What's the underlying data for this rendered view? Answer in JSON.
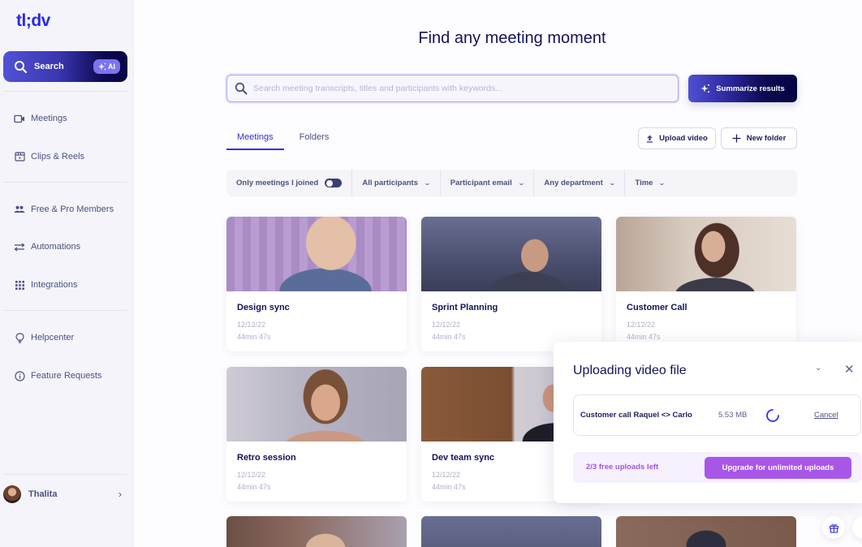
{
  "app": {
    "logo": "tl;dv"
  },
  "sidebar": {
    "search": {
      "label": "Search",
      "ai_badge": "AI",
      "icon": "search-icon"
    },
    "groups": [
      [
        {
          "label": "Meetings",
          "icon": "video-camera-icon"
        },
        {
          "label": "Clips & Reels",
          "icon": "clapperboard-icon"
        }
      ],
      [
        {
          "label": "Free & Pro Members",
          "icon": "people-icon"
        },
        {
          "label": "Automations",
          "icon": "arrows-exchange-icon"
        },
        {
          "label": "Integrations",
          "icon": "grid-icon"
        }
      ],
      [
        {
          "label": "Helpcenter",
          "icon": "lightbulb-icon"
        },
        {
          "label": "Feature Requests",
          "icon": "info-icon"
        }
      ]
    ],
    "user": {
      "name": "Thalita"
    }
  },
  "main": {
    "title": "Find any meeting moment",
    "search": {
      "placeholder": "Search meeting transcripts, titles and participants with keywords...",
      "value": ""
    },
    "summarize_label": "Summarize results",
    "tabs": [
      {
        "label": "Meetings",
        "active": true
      },
      {
        "label": "Folders",
        "active": false
      }
    ],
    "upload_video_label": "Upload video",
    "new_folder_label": "New folder",
    "filters": {
      "only_joined_label": "Only meetings I joined",
      "only_joined_on": false,
      "dropdowns": [
        "All participants",
        "Participant email",
        "Any department",
        "Time"
      ]
    },
    "meetings": [
      {
        "title": "Design sync",
        "date": "12/12/22",
        "duration": "44min 47s"
      },
      {
        "title": "Sprint Planning",
        "date": "12/12/22",
        "duration": "44min 47s"
      },
      {
        "title": "Customer Call",
        "date": "12/12/22",
        "duration": "44min 47s"
      },
      {
        "title": "Retro session",
        "date": "12/12/22",
        "duration": "44min 47s"
      },
      {
        "title": "Dev team sync",
        "date": "12/12/22",
        "duration": "44min 47s"
      }
    ]
  },
  "upload_panel": {
    "title": "Uploading video file",
    "file": {
      "name": "Customer call Raquel <> Carlo",
      "size": "5.53 MB",
      "status": "uploading"
    },
    "cancel_label": "Cancel",
    "quota_text": "2/3 free uploads left",
    "upgrade_label": "Upgrade for unlimited uploads"
  },
  "colors": {
    "brand": "#2b2be0",
    "navy": "#11135a",
    "upgrade": "#a856e8"
  }
}
